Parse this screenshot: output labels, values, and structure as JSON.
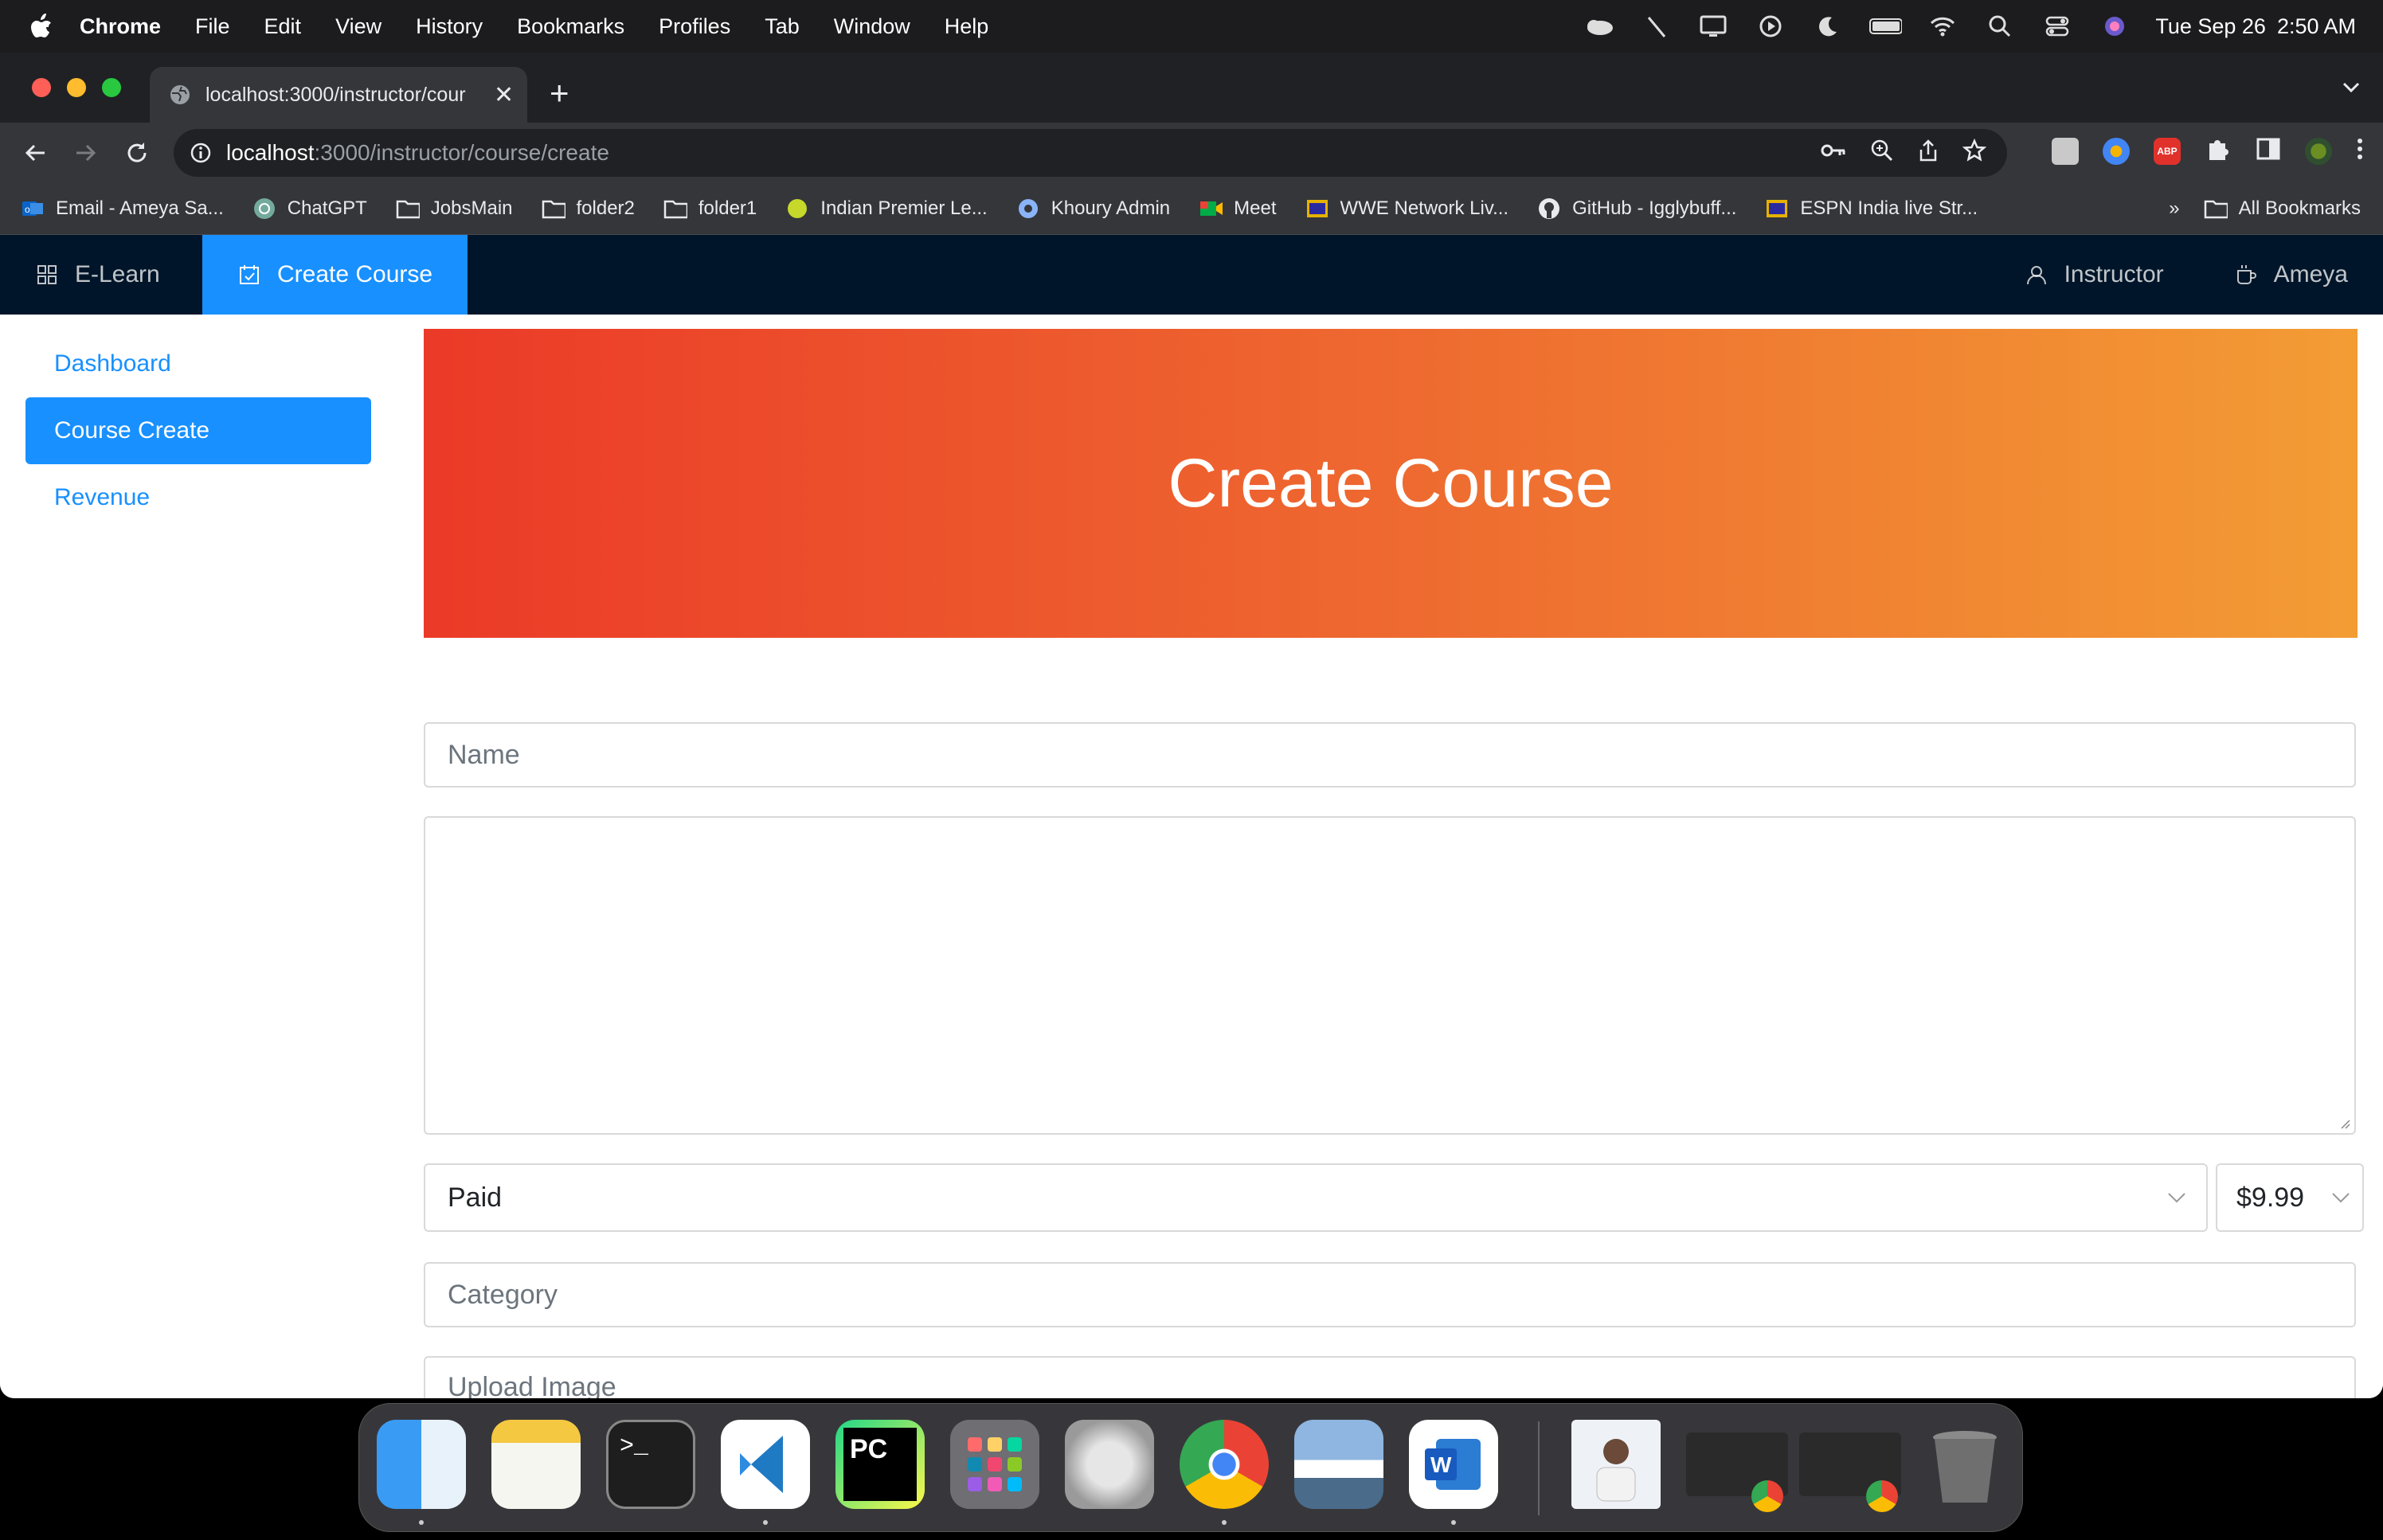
{
  "menubar": {
    "app": "Chrome",
    "items": [
      "File",
      "Edit",
      "View",
      "History",
      "Bookmarks",
      "Profiles",
      "Tab",
      "Window",
      "Help"
    ],
    "date": "Tue Sep 26",
    "time": "2:50 AM"
  },
  "browser": {
    "tab_title": "localhost:3000/instructor/cour",
    "url_host": "localhost",
    "url_path": ":3000/instructor/course/create",
    "bookmarks": [
      {
        "label": "Email - Ameya Sa...",
        "icon": "outlook-icon"
      },
      {
        "label": "ChatGPT",
        "icon": "chatgpt-icon"
      },
      {
        "label": "JobsMain",
        "icon": "folder-icon"
      },
      {
        "label": "folder2",
        "icon": "folder-icon"
      },
      {
        "label": "folder1",
        "icon": "folder-icon"
      },
      {
        "label": "Indian Premier Le...",
        "icon": "ball-icon"
      },
      {
        "label": "Khoury Admin",
        "icon": "khoury-icon"
      },
      {
        "label": "Meet",
        "icon": "meet-icon"
      },
      {
        "label": "WWE Network Liv...",
        "icon": "tv-icon"
      },
      {
        "label": "GitHub - Igglybuff...",
        "icon": "github-icon"
      },
      {
        "label": "ESPN India live Str...",
        "icon": "tv-icon"
      }
    ],
    "bookmarks_overflow": "»",
    "all_bookmarks": "All Bookmarks"
  },
  "appnav": {
    "brand": "E-Learn",
    "active": "Create Course",
    "right": [
      "Instructor",
      "Ameya"
    ]
  },
  "sidebar": {
    "items": [
      "Dashboard",
      "Course Create",
      "Revenue"
    ],
    "active_index": 1
  },
  "hero": {
    "title": "Create Course"
  },
  "form": {
    "name_placeholder": "Name",
    "paid_value": "Paid",
    "price_value": "$9.99",
    "category_placeholder": "Category",
    "upload_label": "Upload Image"
  },
  "colors": {
    "accent": "#1890ff",
    "nav_bg": "#001529",
    "hero_start": "#eb3a28",
    "hero_end": "#f39c34"
  }
}
